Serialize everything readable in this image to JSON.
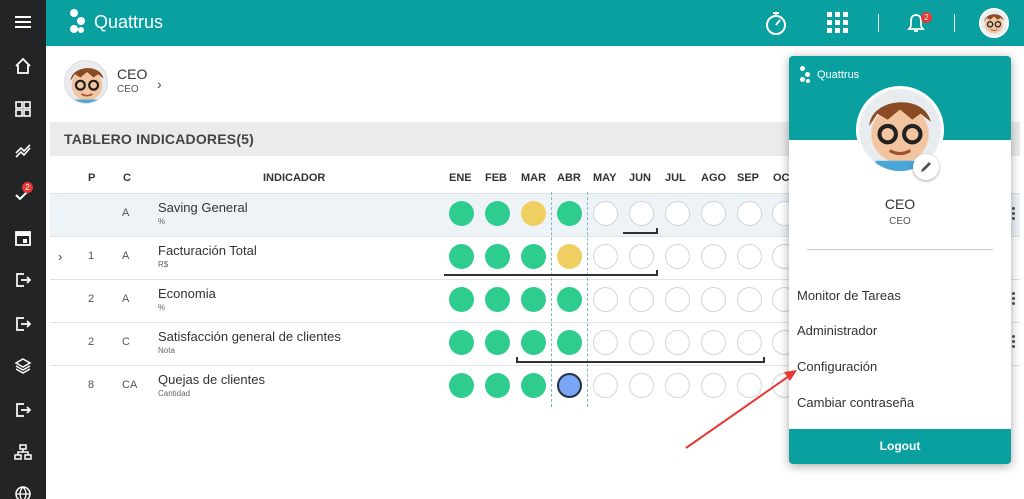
{
  "app": {
    "name": "Quattrus"
  },
  "topbar": {
    "notifications_count": "2"
  },
  "sidebar": {
    "badge_count": "2"
  },
  "user": {
    "name": "CEO",
    "role": "CEO"
  },
  "panel": {
    "title": "TABLERO INDICADORES(5)",
    "columns": {
      "p": "P",
      "c": "C",
      "indicador": "INDICADOR"
    },
    "months": [
      "ENE",
      "FEB",
      "MAR",
      "ABR",
      "MAY",
      "JUN",
      "JUL",
      "AGO",
      "SEP",
      "OC"
    ]
  },
  "rows": [
    {
      "p": "",
      "c": "A",
      "name": "Saving General",
      "unit": "%",
      "status": [
        "green",
        "green",
        "yellow",
        "green",
        "empty",
        "empty",
        "empty",
        "empty",
        "empty",
        "empty"
      ]
    },
    {
      "p": "1",
      "c": "A",
      "name": "Facturación Total",
      "unit": "R$",
      "status": [
        "green",
        "green",
        "green",
        "yellow",
        "empty",
        "empty",
        "empty",
        "empty",
        "empty",
        "empty"
      ]
    },
    {
      "p": "2",
      "c": "A",
      "name": "Economia",
      "unit": "%",
      "status": [
        "green",
        "green",
        "green",
        "green",
        "empty",
        "empty",
        "empty",
        "empty",
        "empty",
        "empty"
      ]
    },
    {
      "p": "2",
      "c": "C",
      "name": "Satisfacción general de clientes",
      "unit": "Nota",
      "status": [
        "green",
        "green",
        "green",
        "green",
        "empty",
        "empty",
        "empty",
        "empty",
        "empty",
        "empty"
      ]
    },
    {
      "p": "8",
      "c": "CA",
      "name": "Quejas de clientes",
      "unit": "Cantidad",
      "status": [
        "green",
        "green",
        "green",
        "blue",
        "empty",
        "empty",
        "empty",
        "empty",
        "empty",
        "empty"
      ]
    }
  ],
  "dropdown": {
    "logo": "Quattrus",
    "name": "CEO",
    "role": "CEO",
    "items": [
      "Monitor de Tareas",
      "Administrador",
      "Configuración",
      "Cambiar contraseña"
    ],
    "logout": "Logout"
  },
  "colors": {
    "brand": "#0aa0a0",
    "green": "#2ecc8f",
    "yellow": "#f0cf62",
    "blue": "#7aa6f7",
    "sidebar": "#222426",
    "annotation": "#e53935"
  }
}
